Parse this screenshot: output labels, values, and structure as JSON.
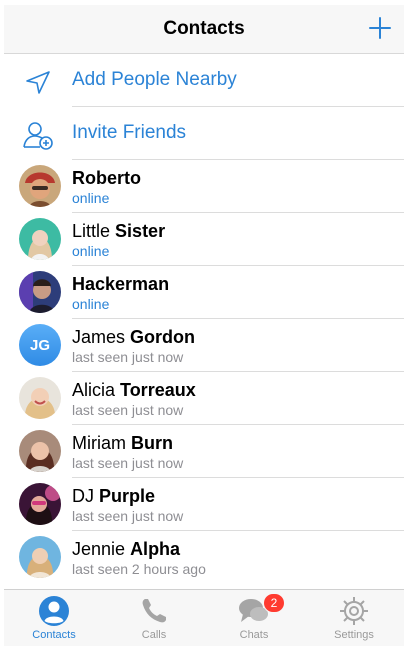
{
  "header": {
    "title": "Contacts"
  },
  "actions": [
    {
      "label": "Add People Nearby",
      "icon": "location-arrow-icon"
    },
    {
      "label": "Invite Friends",
      "icon": "add-user-icon"
    }
  ],
  "contacts": [
    {
      "first": "",
      "last": "Roberto",
      "status": "online",
      "online": true,
      "avatar": "photo"
    },
    {
      "first": "Little",
      "last": "Sister",
      "status": "online",
      "online": true,
      "avatar": "photo"
    },
    {
      "first": "",
      "last": "Hackerman",
      "status": "online",
      "online": true,
      "avatar": "photo"
    },
    {
      "first": "James",
      "last": "Gordon",
      "status": "last seen just now",
      "online": false,
      "avatar": "initials",
      "initials": "JG"
    },
    {
      "first": "Alicia",
      "last": "Torreaux",
      "status": "last seen just now",
      "online": false,
      "avatar": "photo"
    },
    {
      "first": "Miriam",
      "last": "Burn",
      "status": "last seen just now",
      "online": false,
      "avatar": "photo"
    },
    {
      "first": "DJ",
      "last": "Purple",
      "status": "last seen just now",
      "online": false,
      "avatar": "photo"
    },
    {
      "first": "Jennie",
      "last": "Alpha",
      "status": "last seen 2 hours ago",
      "online": false,
      "avatar": "photo"
    }
  ],
  "tabs": [
    {
      "label": "Contacts",
      "icon": "person-icon",
      "active": true
    },
    {
      "label": "Calls",
      "icon": "phone-icon",
      "active": false
    },
    {
      "label": "Chats",
      "icon": "chat-bubble-icon",
      "active": false,
      "badge": "2"
    },
    {
      "label": "Settings",
      "icon": "gear-icon",
      "active": false
    }
  ],
  "colors": {
    "accent": "#2b83d6",
    "badge": "#ff3b30",
    "secondary_text": "#8e8e93"
  }
}
